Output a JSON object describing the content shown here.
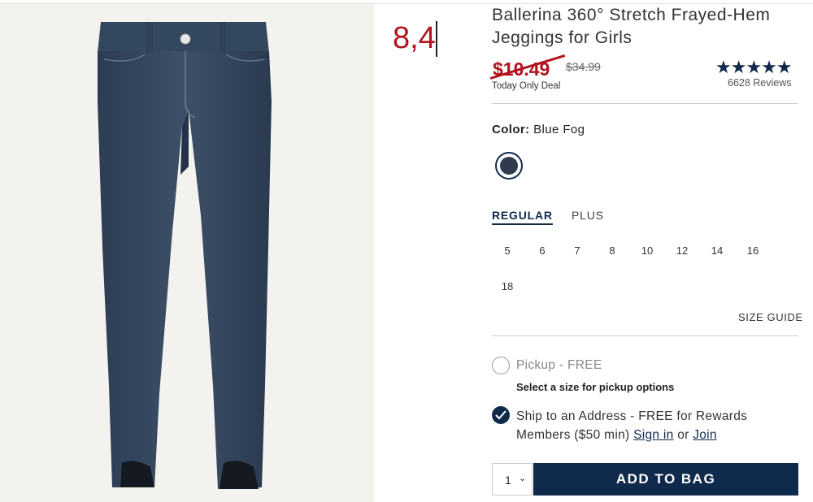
{
  "annotation": "8,4",
  "product": {
    "title": "Ballerina 360° Stretch Frayed-Hem Jeggings for Girls",
    "sale_price": "$10.49",
    "original_price": "$34.99",
    "deal_text": "Today Only Deal",
    "rating_stars": "★★★★★",
    "reviews": "6628 Reviews"
  },
  "color": {
    "label": "Color:",
    "value": "Blue Fog",
    "swatch_hex": "#2e3b4c"
  },
  "size_tabs": {
    "regular": "REGULAR",
    "plus": "PLUS"
  },
  "sizes": [
    "5",
    "6",
    "7",
    "8",
    "10",
    "12",
    "14",
    "16",
    "18"
  ],
  "size_guide": "SIZE GUIDE",
  "fulfillment": {
    "pickup_label": "Pickup - FREE",
    "pickup_note": "Select a size for pickup options",
    "ship_label": "Ship to an Address - FREE for Rewards Members ($50 min)",
    "sign_in": "Sign in",
    "or": "or",
    "join": "Join"
  },
  "quantity": "1",
  "add_to_bag": "ADD TO BAG",
  "colors": {
    "brand_navy": "#102a4c",
    "sale_red": "#b3121e"
  }
}
